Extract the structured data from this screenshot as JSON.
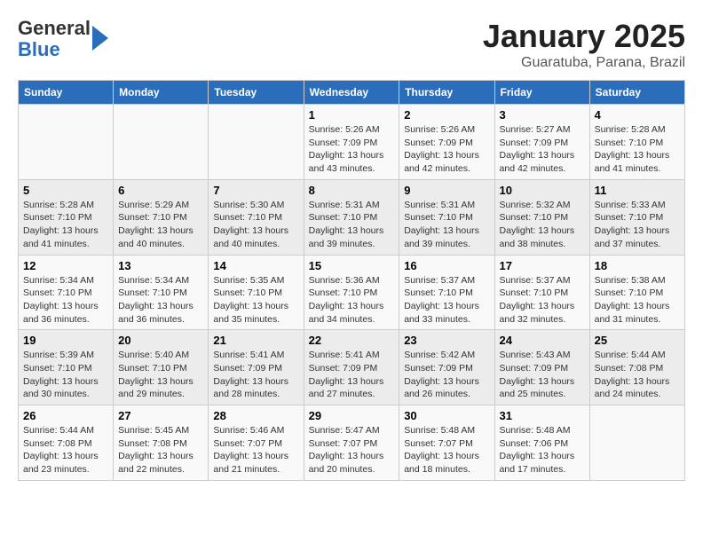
{
  "header": {
    "logo_line1": "General",
    "logo_line2": "Blue",
    "title": "January 2025",
    "subtitle": "Guaratuba, Parana, Brazil"
  },
  "days_of_week": [
    "Sunday",
    "Monday",
    "Tuesday",
    "Wednesday",
    "Thursday",
    "Friday",
    "Saturday"
  ],
  "weeks": [
    [
      {
        "day": "",
        "info": ""
      },
      {
        "day": "",
        "info": ""
      },
      {
        "day": "",
        "info": ""
      },
      {
        "day": "1",
        "info": "Sunrise: 5:26 AM\nSunset: 7:09 PM\nDaylight: 13 hours\nand 43 minutes."
      },
      {
        "day": "2",
        "info": "Sunrise: 5:26 AM\nSunset: 7:09 PM\nDaylight: 13 hours\nand 42 minutes."
      },
      {
        "day": "3",
        "info": "Sunrise: 5:27 AM\nSunset: 7:09 PM\nDaylight: 13 hours\nand 42 minutes."
      },
      {
        "day": "4",
        "info": "Sunrise: 5:28 AM\nSunset: 7:10 PM\nDaylight: 13 hours\nand 41 minutes."
      }
    ],
    [
      {
        "day": "5",
        "info": "Sunrise: 5:28 AM\nSunset: 7:10 PM\nDaylight: 13 hours\nand 41 minutes."
      },
      {
        "day": "6",
        "info": "Sunrise: 5:29 AM\nSunset: 7:10 PM\nDaylight: 13 hours\nand 40 minutes."
      },
      {
        "day": "7",
        "info": "Sunrise: 5:30 AM\nSunset: 7:10 PM\nDaylight: 13 hours\nand 40 minutes."
      },
      {
        "day": "8",
        "info": "Sunrise: 5:31 AM\nSunset: 7:10 PM\nDaylight: 13 hours\nand 39 minutes."
      },
      {
        "day": "9",
        "info": "Sunrise: 5:31 AM\nSunset: 7:10 PM\nDaylight: 13 hours\nand 39 minutes."
      },
      {
        "day": "10",
        "info": "Sunrise: 5:32 AM\nSunset: 7:10 PM\nDaylight: 13 hours\nand 38 minutes."
      },
      {
        "day": "11",
        "info": "Sunrise: 5:33 AM\nSunset: 7:10 PM\nDaylight: 13 hours\nand 37 minutes."
      }
    ],
    [
      {
        "day": "12",
        "info": "Sunrise: 5:34 AM\nSunset: 7:10 PM\nDaylight: 13 hours\nand 36 minutes."
      },
      {
        "day": "13",
        "info": "Sunrise: 5:34 AM\nSunset: 7:10 PM\nDaylight: 13 hours\nand 36 minutes."
      },
      {
        "day": "14",
        "info": "Sunrise: 5:35 AM\nSunset: 7:10 PM\nDaylight: 13 hours\nand 35 minutes."
      },
      {
        "day": "15",
        "info": "Sunrise: 5:36 AM\nSunset: 7:10 PM\nDaylight: 13 hours\nand 34 minutes."
      },
      {
        "day": "16",
        "info": "Sunrise: 5:37 AM\nSunset: 7:10 PM\nDaylight: 13 hours\nand 33 minutes."
      },
      {
        "day": "17",
        "info": "Sunrise: 5:37 AM\nSunset: 7:10 PM\nDaylight: 13 hours\nand 32 minutes."
      },
      {
        "day": "18",
        "info": "Sunrise: 5:38 AM\nSunset: 7:10 PM\nDaylight: 13 hours\nand 31 minutes."
      }
    ],
    [
      {
        "day": "19",
        "info": "Sunrise: 5:39 AM\nSunset: 7:10 PM\nDaylight: 13 hours\nand 30 minutes."
      },
      {
        "day": "20",
        "info": "Sunrise: 5:40 AM\nSunset: 7:10 PM\nDaylight: 13 hours\nand 29 minutes."
      },
      {
        "day": "21",
        "info": "Sunrise: 5:41 AM\nSunset: 7:09 PM\nDaylight: 13 hours\nand 28 minutes."
      },
      {
        "day": "22",
        "info": "Sunrise: 5:41 AM\nSunset: 7:09 PM\nDaylight: 13 hours\nand 27 minutes."
      },
      {
        "day": "23",
        "info": "Sunrise: 5:42 AM\nSunset: 7:09 PM\nDaylight: 13 hours\nand 26 minutes."
      },
      {
        "day": "24",
        "info": "Sunrise: 5:43 AM\nSunset: 7:09 PM\nDaylight: 13 hours\nand 25 minutes."
      },
      {
        "day": "25",
        "info": "Sunrise: 5:44 AM\nSunset: 7:08 PM\nDaylight: 13 hours\nand 24 minutes."
      }
    ],
    [
      {
        "day": "26",
        "info": "Sunrise: 5:44 AM\nSunset: 7:08 PM\nDaylight: 13 hours\nand 23 minutes."
      },
      {
        "day": "27",
        "info": "Sunrise: 5:45 AM\nSunset: 7:08 PM\nDaylight: 13 hours\nand 22 minutes."
      },
      {
        "day": "28",
        "info": "Sunrise: 5:46 AM\nSunset: 7:07 PM\nDaylight: 13 hours\nand 21 minutes."
      },
      {
        "day": "29",
        "info": "Sunrise: 5:47 AM\nSunset: 7:07 PM\nDaylight: 13 hours\nand 20 minutes."
      },
      {
        "day": "30",
        "info": "Sunrise: 5:48 AM\nSunset: 7:07 PM\nDaylight: 13 hours\nand 18 minutes."
      },
      {
        "day": "31",
        "info": "Sunrise: 5:48 AM\nSunset: 7:06 PM\nDaylight: 13 hours\nand 17 minutes."
      },
      {
        "day": "",
        "info": ""
      }
    ]
  ]
}
